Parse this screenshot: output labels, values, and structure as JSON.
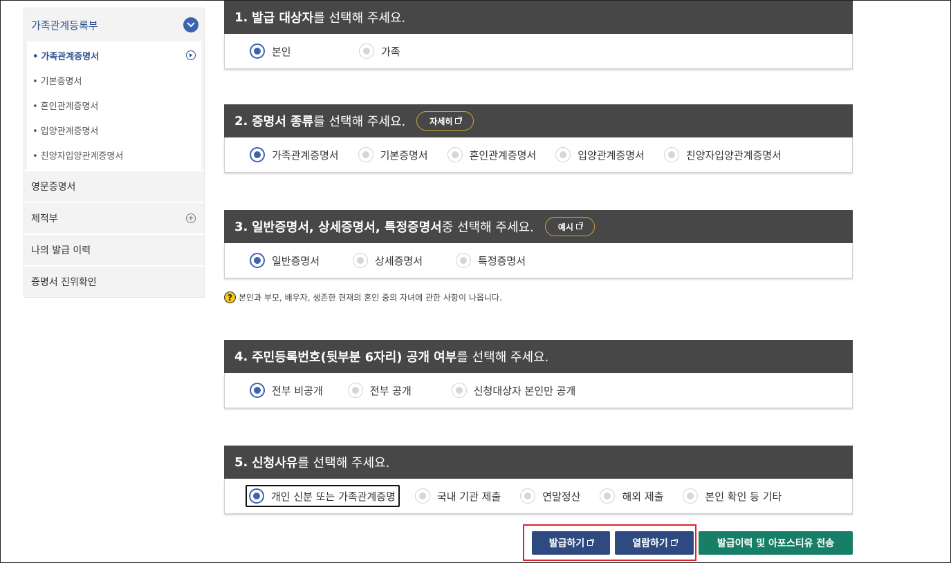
{
  "sidebar": {
    "header": "가족관계등록부",
    "sub_items": [
      {
        "label": "가족관계증명서"
      },
      {
        "label": "기본증명서"
      },
      {
        "label": "혼인관계증명서"
      },
      {
        "label": "입양관계증명서"
      },
      {
        "label": "친양자입양관계증명서"
      }
    ],
    "rows": [
      {
        "label": "영문증명서"
      },
      {
        "label": "제적부"
      },
      {
        "label": "나의 발급 이력"
      },
      {
        "label": "증명서 진위확인"
      }
    ],
    "bullet": "•"
  },
  "sections": [
    {
      "num": "1.",
      "bold": "발급 대상자",
      "rest": "를 선택해 주세요.",
      "options": [
        "본인",
        "가족"
      ],
      "selected": 0
    },
    {
      "num": "2.",
      "bold": "증명서 종류",
      "rest": "를 선택해 주세요.",
      "pill": "자세히",
      "options": [
        "가족관계증명서",
        "기본증명서",
        "혼인관계증명서",
        "입양관계증명서",
        "친양자입양관계증명서"
      ],
      "selected": 0
    },
    {
      "num": "3.",
      "bold": "일반증명서, 상세증명서, 특정증명서",
      "rest": " 중 선택해 주세요.",
      "pill": "예시",
      "options": [
        "일반증명서",
        "상세증명서",
        "특정증명서"
      ],
      "selected": 0
    },
    {
      "num": "4.",
      "bold": "주민등록번호(뒷부분 6자리) 공개 여부",
      "rest": "를 선택해 주세요.",
      "options": [
        "전부 비공개",
        "전부 공개",
        "신청대상자 본인만 공개"
      ],
      "selected": 0
    },
    {
      "num": "5.",
      "bold": "신청사유",
      "rest": "를 선택해 주세요.",
      "options": [
        "개인 신분 또는 가족관계증명",
        "국내 기관 제출",
        "연말정산",
        "해외 제출",
        "본인 확인 등 기타"
      ],
      "selected": 0
    }
  ],
  "note": {
    "icon": "?",
    "text": "본인과 부모, 배우자, 생존한 현재의 혼인 중의 자녀에 관한 사항이 나옵니다."
  },
  "buttons": {
    "issue": "발급하기",
    "view": "열람하기",
    "send": "발급이력 및 아포스티유 전송"
  },
  "colors": {
    "header_bg": "#474747",
    "accent": "#3b64b0",
    "button_blue": "#2f4a80",
    "button_green": "#177f67",
    "highlight": "#d9232d"
  }
}
